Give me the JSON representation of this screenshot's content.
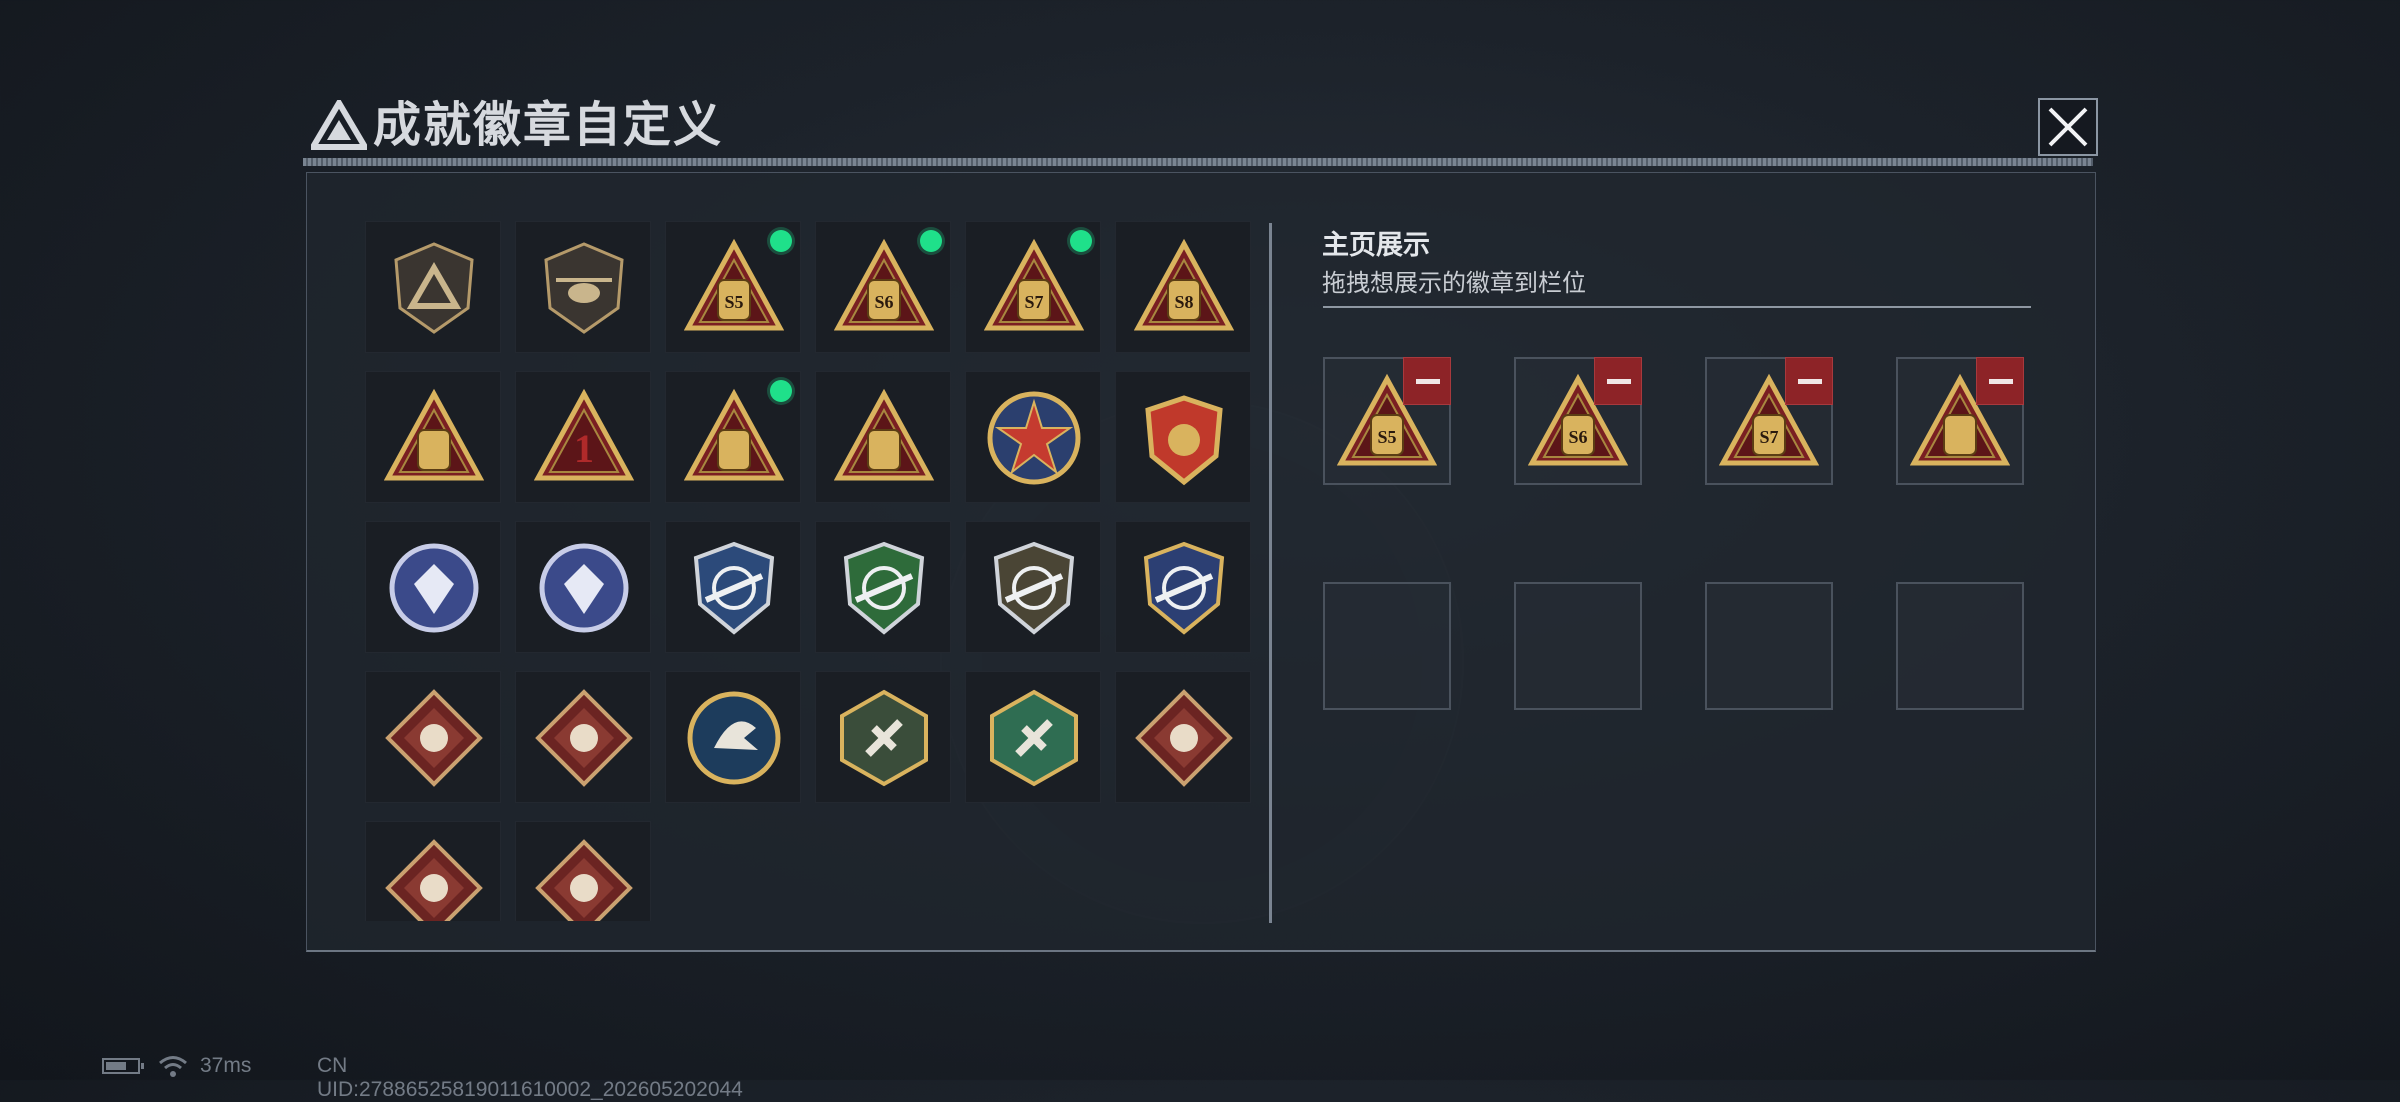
{
  "window": {
    "title": "成就徽章自定义",
    "title_icon": "triangle-logo-icon",
    "close_icon": "close-icon"
  },
  "badges": [
    {
      "icon": "shield-triangle-badge",
      "new": false
    },
    {
      "icon": "helicopter-badge",
      "new": false
    },
    {
      "icon": "season-s5-badge",
      "label": "S5",
      "new": true
    },
    {
      "icon": "season-s6-badge",
      "label": "S6",
      "new": true
    },
    {
      "icon": "season-s7-badge",
      "label": "S7",
      "new": true
    },
    {
      "icon": "season-s8-badge",
      "label": "S8",
      "new": false
    },
    {
      "icon": "boat-triangle-badge",
      "new": false
    },
    {
      "icon": "rank-one-badge",
      "label": "1",
      "new": false
    },
    {
      "icon": "bag-triangle-badge",
      "new": true
    },
    {
      "icon": "soldiers-triangle-badge",
      "new": false
    },
    {
      "icon": "star-medal-badge",
      "new": false
    },
    {
      "icon": "crest-shield-badge",
      "new": false
    },
    {
      "icon": "diamond-shield-badge",
      "new": false
    },
    {
      "icon": "skull-roundel-badge",
      "new": false
    },
    {
      "icon": "rifle-blue-shield-badge",
      "new": false
    },
    {
      "icon": "rifle-green-shield-badge",
      "new": false
    },
    {
      "icon": "crosshair-shield-badge",
      "new": false
    },
    {
      "icon": "gold-wing-shield-badge",
      "new": false
    },
    {
      "icon": "wolf-diamond-badge",
      "new": false
    },
    {
      "icon": "wolf-diamond-badge-2",
      "new": false
    },
    {
      "icon": "eagle-roundel-badge",
      "new": false
    },
    {
      "icon": "wasp-hexagon-badge",
      "new": false
    },
    {
      "icon": "medic-hexagon-badge",
      "new": false
    },
    {
      "icon": "dragon-diamond-badge",
      "new": false
    },
    {
      "icon": "dragon-diamond-badge-2",
      "new": false
    },
    {
      "icon": "runner-diamond-badge",
      "new": false
    }
  ],
  "display": {
    "title": "主页展示",
    "subtitle": "拖拽想展示的徽章到栏位",
    "slots": [
      {
        "badge": "season-s5-badge",
        "label": "S5"
      },
      {
        "badge": "season-s6-badge",
        "label": "S6"
      },
      {
        "badge": "season-s7-badge",
        "label": "S7"
      },
      {
        "badge": "bag-triangle-badge",
        "label": ""
      },
      {
        "badge": null
      },
      {
        "badge": null
      },
      {
        "badge": null
      },
      {
        "badge": null
      }
    ],
    "remove_icon": "minus-icon"
  },
  "status": {
    "ping": "37ms",
    "uid": "CN UID:27886525819011610002_202605202044",
    "battery_icon": "battery-icon",
    "wifi_icon": "wifi-icon"
  },
  "colors": {
    "accent_green": "#1fe08a",
    "remove_red": "#8d2327",
    "badge_gold": "#d9b35e",
    "badge_red": "#7a1f22"
  }
}
